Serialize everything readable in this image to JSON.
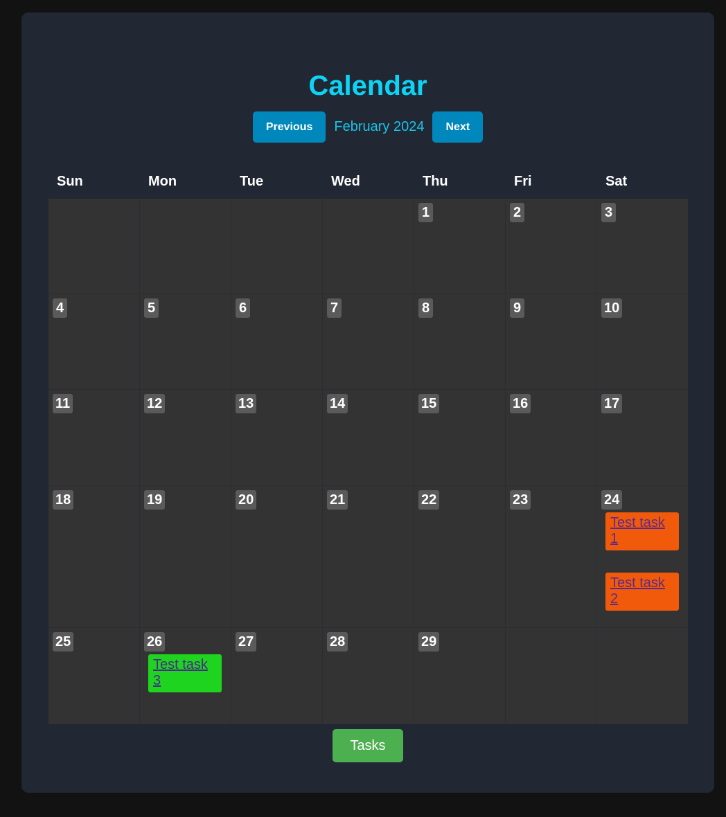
{
  "header": {
    "title": "Calendar",
    "prev_label": "Previous",
    "next_label": "Next",
    "month_label": "February 2024"
  },
  "weekdays": [
    "Sun",
    "Mon",
    "Tue",
    "Wed",
    "Thu",
    "Fri",
    "Sat"
  ],
  "weeks": [
    [
      null,
      null,
      null,
      null,
      {
        "day": "1"
      },
      {
        "day": "2"
      },
      {
        "day": "3"
      }
    ],
    [
      {
        "day": "4"
      },
      {
        "day": "5"
      },
      {
        "day": "6"
      },
      {
        "day": "7"
      },
      {
        "day": "8"
      },
      {
        "day": "9"
      },
      {
        "day": "10"
      }
    ],
    [
      {
        "day": "11"
      },
      {
        "day": "12"
      },
      {
        "day": "13"
      },
      {
        "day": "14"
      },
      {
        "day": "15"
      },
      {
        "day": "16"
      },
      {
        "day": "17"
      }
    ],
    [
      {
        "day": "18"
      },
      {
        "day": "19"
      },
      {
        "day": "20"
      },
      {
        "day": "21"
      },
      {
        "day": "22"
      },
      {
        "day": "23"
      },
      {
        "day": "24",
        "tasks": [
          {
            "label": "Test task 1",
            "color": "#f05a0a"
          },
          {
            "label": "Test task 2",
            "color": "#f05a0a"
          }
        ]
      }
    ],
    [
      {
        "day": "25"
      },
      {
        "day": "26",
        "tasks": [
          {
            "label": "Test task 3",
            "color": "#1ed41e"
          }
        ]
      },
      {
        "day": "27"
      },
      {
        "day": "28"
      },
      {
        "day": "29"
      },
      null,
      null
    ]
  ],
  "footer": {
    "tasks_label": "Tasks"
  },
  "colors": {
    "accent": "#0dd4f5",
    "nav_button": "#0088bd",
    "tasks_button": "#4caf50",
    "task_orange": "#f05a0a",
    "task_green": "#1ed41e"
  }
}
